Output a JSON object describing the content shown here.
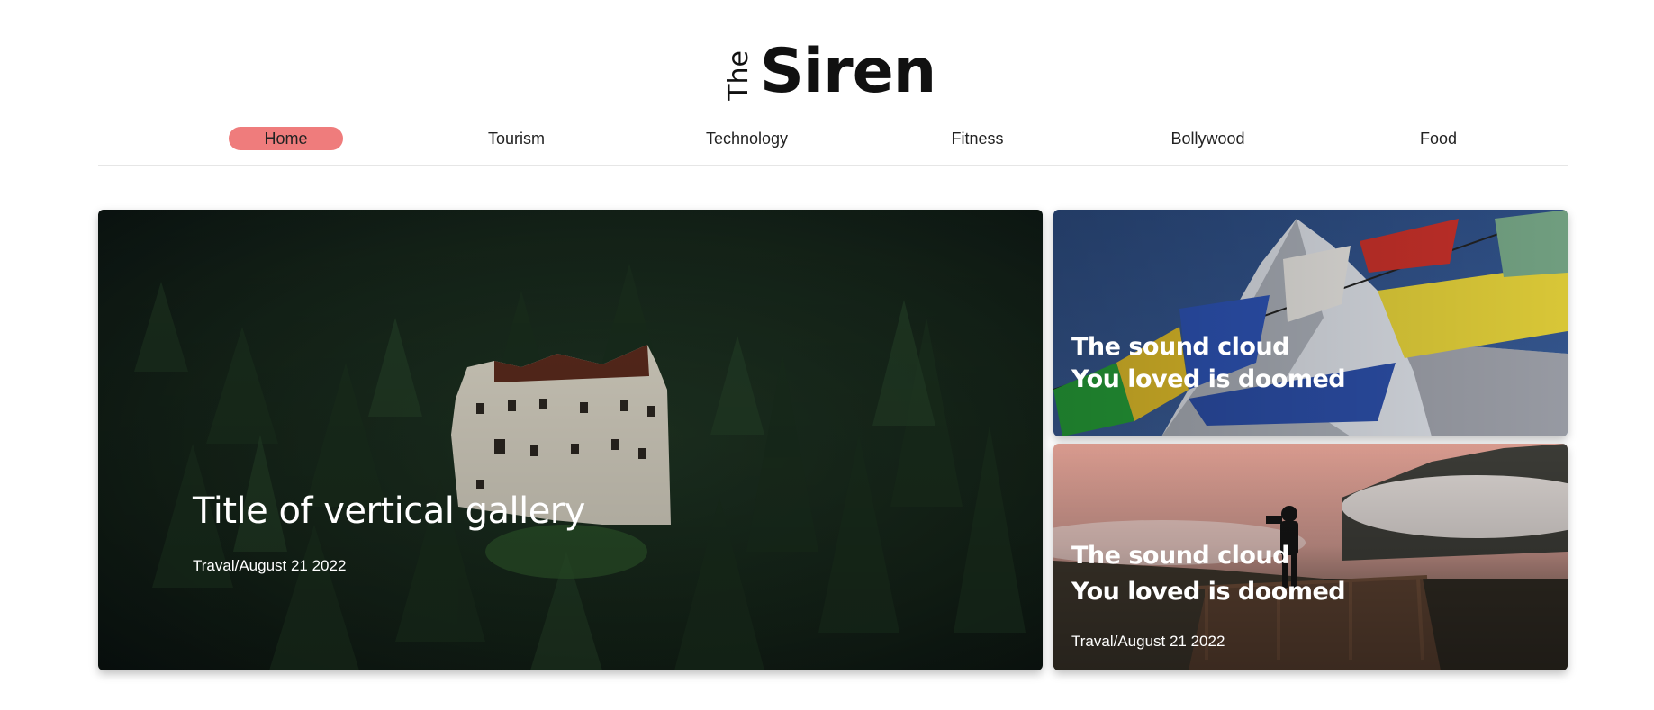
{
  "brand": {
    "prefix": "The",
    "name": "Siren"
  },
  "nav": {
    "items": [
      {
        "label": "Home",
        "active": true
      },
      {
        "label": "Tourism",
        "active": false
      },
      {
        "label": "Technology",
        "active": false
      },
      {
        "label": "Fitness",
        "active": false
      },
      {
        "label": "Bollywood",
        "active": false
      },
      {
        "label": "Food",
        "active": false
      }
    ],
    "active_color": "#ef7c7c"
  },
  "gallery": {
    "main": {
      "title": "Title of vertical gallery",
      "meta": "Traval/August 21 2022",
      "image": "forest-castle-ruins"
    },
    "side": [
      {
        "title_line1": "The sound cloud",
        "title_line2": "You loved is doomed",
        "image": "prayer-flags-mountain"
      },
      {
        "title_line1": "The sound cloud",
        "title_line2": "You loved is doomed",
        "meta": "Traval/August 21 2022",
        "image": "photographer-on-deck"
      }
    ]
  }
}
